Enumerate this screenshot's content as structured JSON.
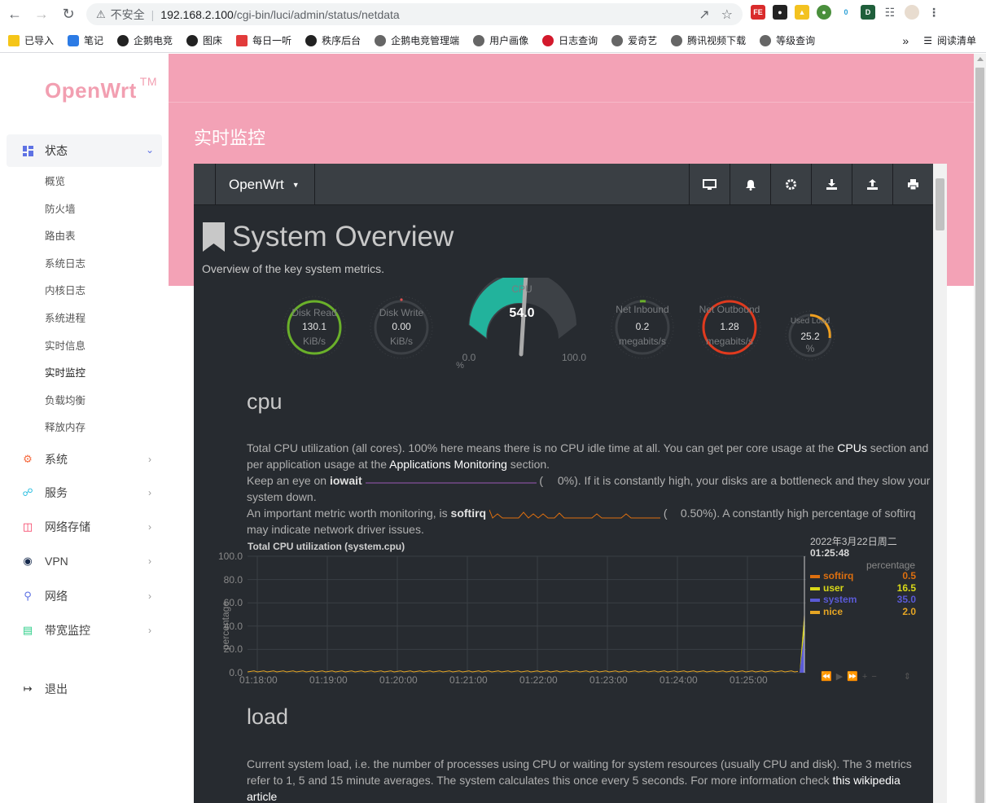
{
  "browser": {
    "security_label": "不安全",
    "url_host": "192.168.2.100",
    "url_path": "/cgi-bin/luci/admin/status/netdata",
    "bookmarks": [
      "已导入",
      "笔记",
      "企鹅电竞",
      "图床",
      "每日一听",
      "秩序后台",
      "企鹅电竞管理端",
      "用户画像",
      "日志查询",
      "爱奇艺",
      "腾讯视频下载",
      "等级查询"
    ],
    "bookmarks_more": "»",
    "reading_list": "阅读清单"
  },
  "sidebar": {
    "logo": "OpenWrt",
    "logo_tm": "TM",
    "status": "状态",
    "submenu": [
      "概览",
      "防火墙",
      "路由表",
      "系统日志",
      "内核日志",
      "系统进程",
      "实时信息",
      "实时监控",
      "负载均衡",
      "释放内存"
    ],
    "items": [
      "系统",
      "服务",
      "网络存储",
      "VPN",
      "网络",
      "带宽监控"
    ],
    "logout": "退出"
  },
  "page": {
    "title": "实时监控"
  },
  "netdata": {
    "brand": "OpenWrt",
    "overview_title": "System Overview",
    "overview_subtitle": "Overview of the key system metrics.",
    "gauges": {
      "disk_read": {
        "label": "Disk Read",
        "value": "130.1",
        "unit": "KiB/s"
      },
      "disk_write": {
        "label": "Disk Write",
        "value": "0.00",
        "unit": "KiB/s"
      },
      "cpu": {
        "label": "CPU",
        "value": "54.0",
        "min": "0.0",
        "max": "100.0",
        "unit": "%"
      },
      "net_in": {
        "label": "Net Inbound",
        "value": "0.2",
        "unit": "megabits/s"
      },
      "net_out": {
        "label": "Net Outbound",
        "value": "1.28",
        "unit": "megabits/s"
      },
      "load": {
        "label": "Used Load",
        "value": "25.2",
        "unit": "%"
      }
    },
    "cpu_section": {
      "title": "cpu",
      "p1_a": "Total CPU utilization (all cores). 100% here means there is no CPU idle time at all. You can get per core usage at the ",
      "p1_link1": "CPUs",
      "p1_b": " section and per application usage at the ",
      "p1_link2": "Applications Monitoring",
      "p1_c": " section.",
      "p2_a": "Keep an eye on ",
      "p2_bold": "iowait",
      "p2_val": "0%",
      "p2_b": "). If it is constantly high, your disks are a bottleneck and they slow your system down.",
      "p3_a": "An important metric worth monitoring, is ",
      "p3_bold": "softirq",
      "p3_val": "0.50%",
      "p3_b": "). A constantly high percentage of softirq may indicate network driver issues."
    },
    "chart_title": "Total CPU utilization (system.cpu)",
    "legend_date": "2022年3月22日周二",
    "legend_time": "01:25:48",
    "legend_units": "percentage",
    "load_section": {
      "title": "load",
      "p1": "Current system load, i.e. the number of processes using CPU or waiting for system resources (usually CPU and disk). The 3 metrics refer to 1, 5 and 15 minute averages. The system calculates this once every 5 seconds. For more information check ",
      "link": "this wikipedia article"
    }
  },
  "chart_data": {
    "type": "area",
    "title": "Total CPU utilization (system.cpu)",
    "ylabel": "percentage",
    "ylim": [
      0,
      100
    ],
    "yticks": [
      "100.0",
      "80.0",
      "60.0",
      "40.0",
      "20.0",
      "0.0"
    ],
    "x": [
      "01:18:00",
      "01:19:00",
      "01:20:00",
      "01:21:00",
      "01:22:00",
      "01:23:00",
      "01:24:00",
      "01:25:00"
    ],
    "series": [
      {
        "name": "softirq",
        "color": "#dd6f0f",
        "value": "0.5"
      },
      {
        "name": "user",
        "color": "#d8d818",
        "value": "16.5"
      },
      {
        "name": "system",
        "color": "#5a5ad6",
        "value": "35.0"
      },
      {
        "name": "nice",
        "color": "#e5a524",
        "value": "2.0"
      }
    ]
  },
  "colors": {
    "pink": "#f3a2b6",
    "accent": "#5e72e4",
    "netdata_bg": "#272b30"
  }
}
